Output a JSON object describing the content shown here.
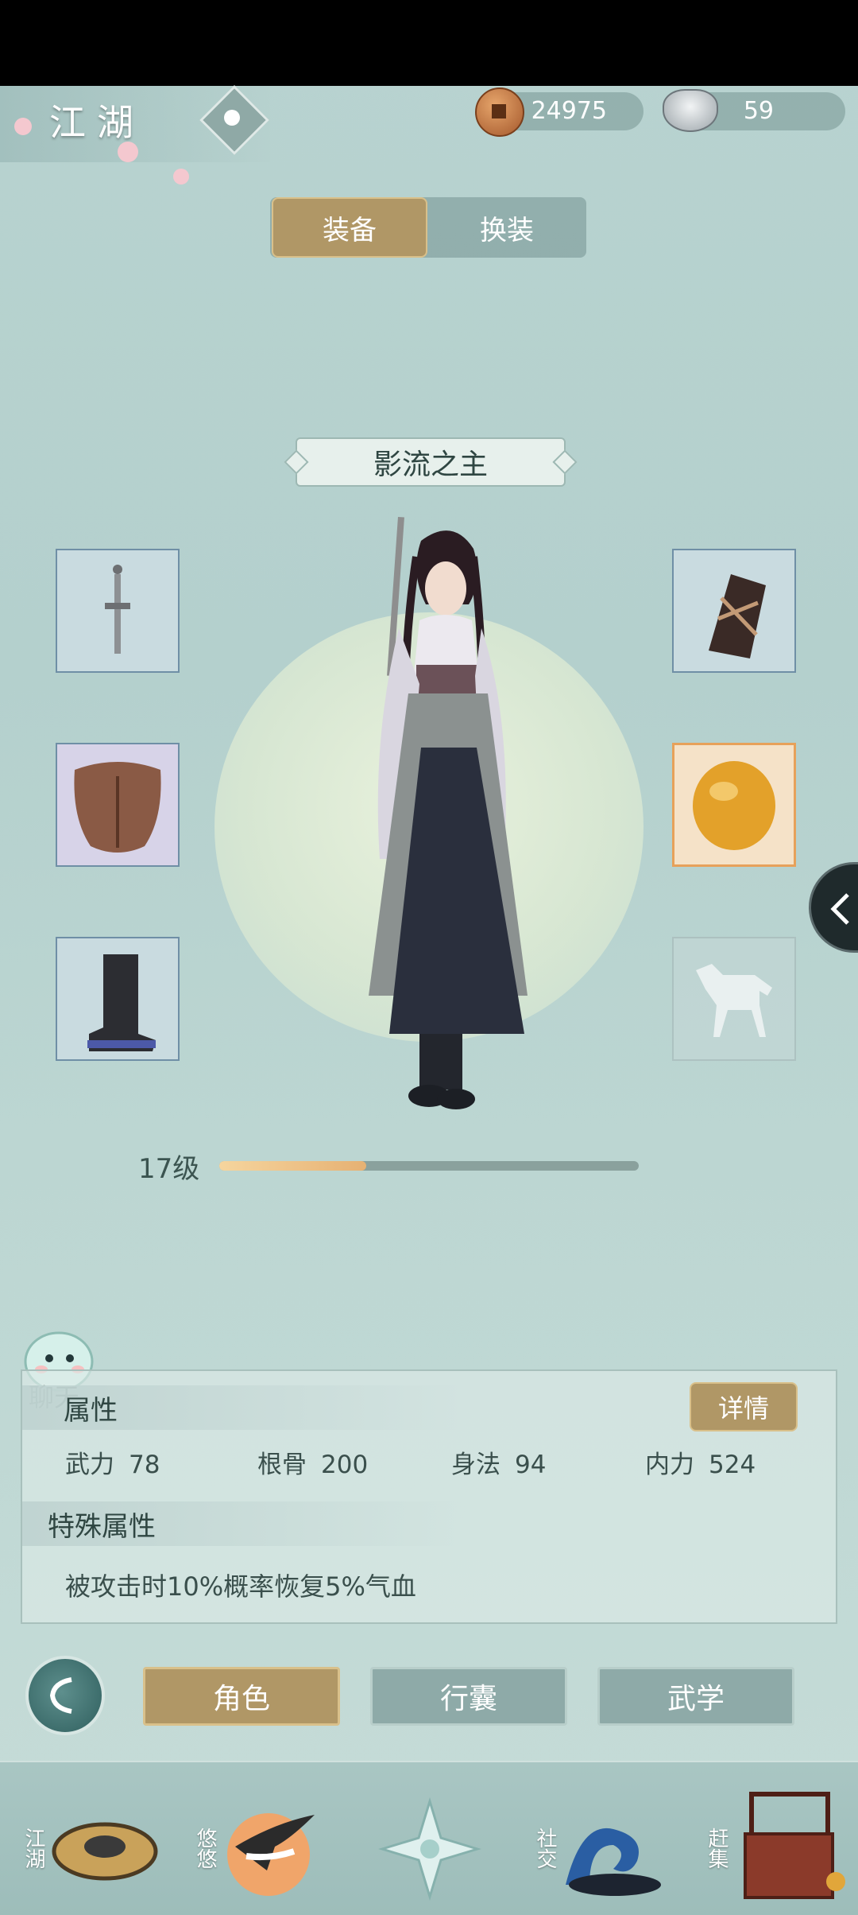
{
  "header": {
    "title": "江湖",
    "copper": "24975",
    "silver": "59"
  },
  "tabs": [
    {
      "label": "装备",
      "active": true
    },
    {
      "label": "换装",
      "active": false
    }
  ],
  "character": {
    "name": "影流之主",
    "level_label": "17级",
    "level_progress": 0.35
  },
  "equipment": {
    "left": [
      "sword-icon",
      "armor-icon",
      "boots-icon"
    ],
    "right": [
      "bracer-icon",
      "amber-gem-icon",
      "horse-icon"
    ]
  },
  "attributes": {
    "section_title": "属性",
    "detail_button": "详情",
    "stats": [
      {
        "name": "武力",
        "value": "78"
      },
      {
        "name": "根骨",
        "value": "200"
      },
      {
        "name": "身法",
        "value": "94"
      },
      {
        "name": "内力",
        "value": "524"
      }
    ],
    "special_title": "特殊属性",
    "special_text": "被攻击时10%概率恢复5%气血"
  },
  "chat": {
    "label": "聊天"
  },
  "nav": [
    {
      "label": "角色",
      "active": true
    },
    {
      "label": "行囊",
      "active": false
    },
    {
      "label": "武学",
      "active": false
    }
  ],
  "bottom_bar": [
    {
      "label": "江湖",
      "icon": "bamboo-hat-icon"
    },
    {
      "label": "悠悠",
      "icon": "crane-icon"
    },
    {
      "label": "",
      "icon": "compass-star-icon"
    },
    {
      "label": "社交",
      "icon": "wave-icon"
    },
    {
      "label": "赶集",
      "icon": "market-basket-icon"
    }
  ],
  "colors": {
    "gold_button": "#b09766",
    "panel_teal": "#b4d0cd",
    "level_fill": "#e6b173"
  }
}
